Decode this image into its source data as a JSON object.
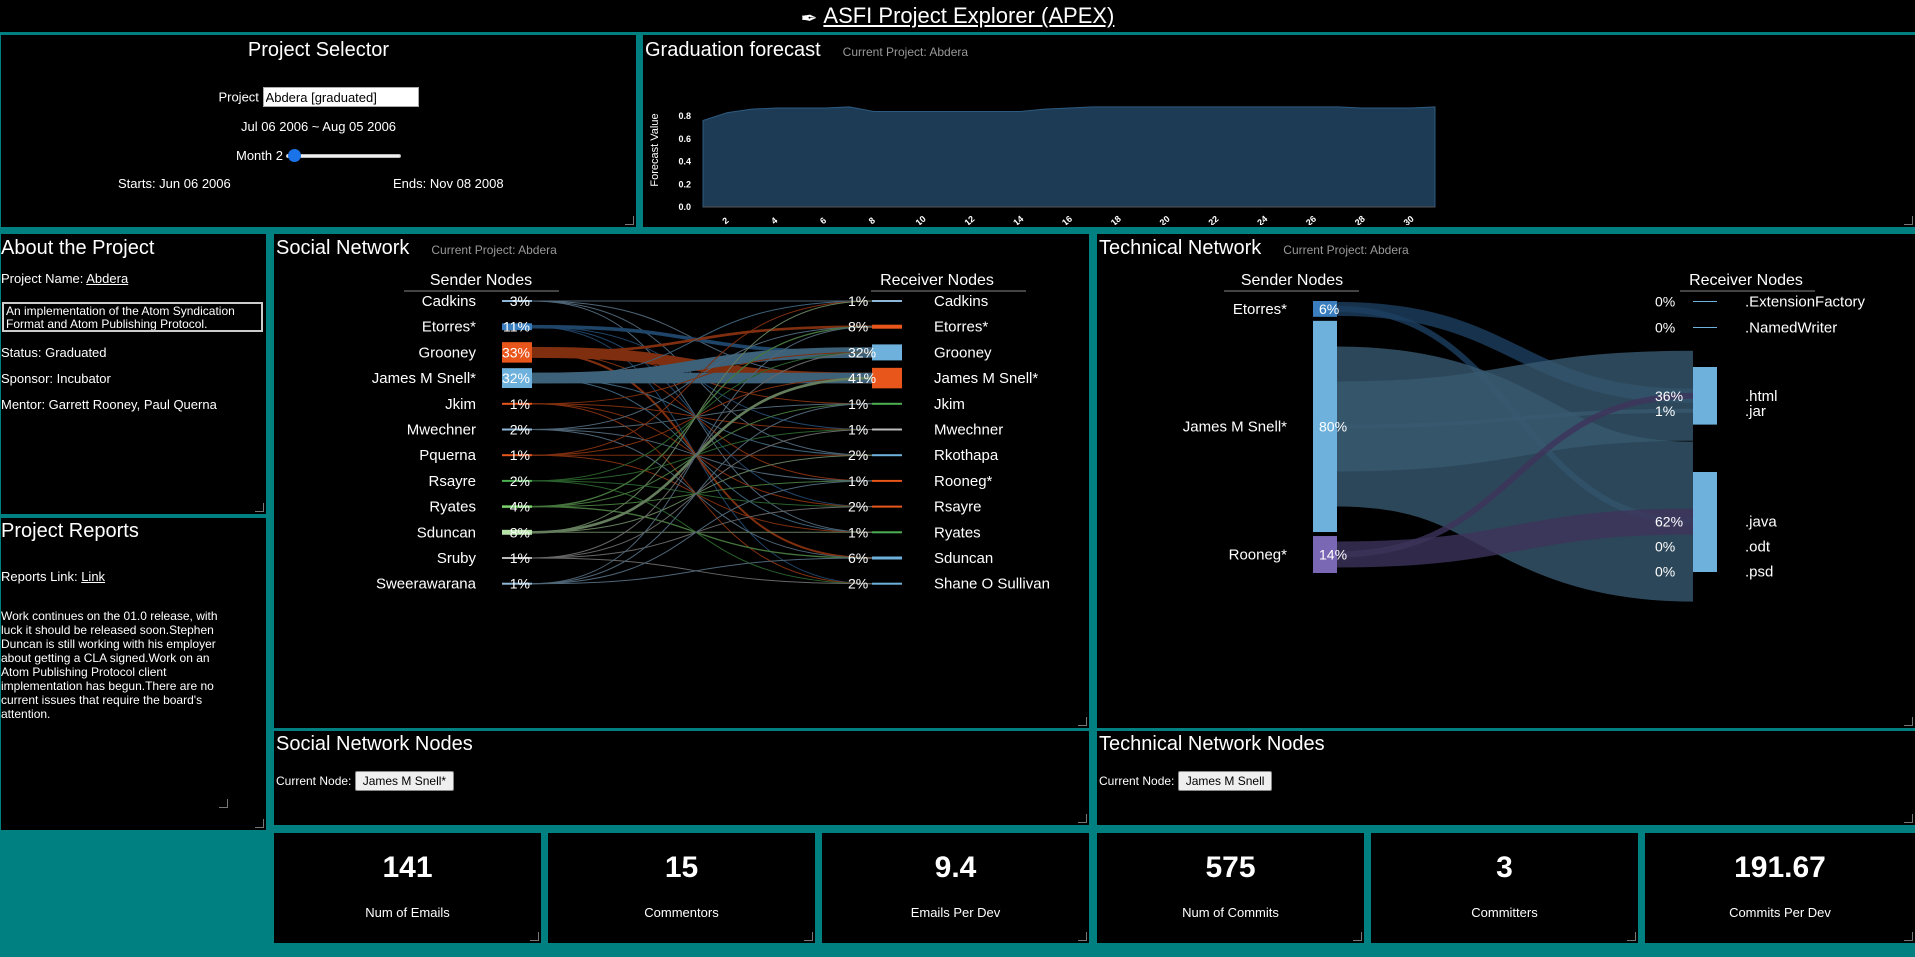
{
  "app": {
    "title": "ASFI Project Explorer (APEX)"
  },
  "selector": {
    "title": "Project Selector",
    "project_label": "Project",
    "project_value": "Abdera [graduated]",
    "range": "Jul 06 2006 ~ Aug 05 2006",
    "month_label": "Month 2",
    "month_progress": 0.02,
    "starts": "Starts: Jun 06 2006",
    "ends": "Ends: Nov 08 2008"
  },
  "forecast": {
    "title": "Graduation forecast",
    "subtitle": "Current Project:  Abdera",
    "chart_data": {
      "type": "area",
      "ylabel": "Forecast Value",
      "ylim": [
        0,
        1
      ],
      "yticks": [
        "0.0",
        "0.2",
        "0.4",
        "0.6",
        "0.8"
      ],
      "xticks": [
        "2",
        "4",
        "6",
        "8",
        "10",
        "12",
        "14",
        "16",
        "18",
        "20",
        "22",
        "24",
        "26",
        "28",
        "30"
      ],
      "x": [
        1,
        2,
        3,
        4,
        5,
        6,
        7,
        8,
        9,
        10,
        11,
        12,
        13,
        14,
        15,
        16,
        17,
        18,
        19,
        20,
        21,
        22,
        23,
        24,
        25,
        26,
        27,
        28,
        29,
        30,
        31
      ],
      "values": [
        0.76,
        0.83,
        0.86,
        0.87,
        0.87,
        0.87,
        0.88,
        0.84,
        0.84,
        0.84,
        0.84,
        0.84,
        0.84,
        0.84,
        0.86,
        0.87,
        0.88,
        0.88,
        0.88,
        0.88,
        0.88,
        0.88,
        0.88,
        0.88,
        0.88,
        0.88,
        0.88,
        0.87,
        0.87,
        0.87,
        0.88
      ],
      "color": "#1d3b55"
    }
  },
  "about": {
    "title": "About the Project",
    "name_label": "Project Name: ",
    "name": "Abdera",
    "description": "An implementation of the Atom Syndication Format and Atom Publishing Protocol.",
    "status": "Status: Graduated",
    "sponsor": "Sponsor: Incubator",
    "mentor": "Mentor: Garrett Rooney, Paul Querna"
  },
  "reports": {
    "title": "Project Reports",
    "link_label": "Reports Link: ",
    "link_text": "Link",
    "text": "Work continues on the 01.0 release, with luck it should be released soon.Stephen Duncan is still working with his employer about getting a CLA signed.Work on an Atom Publishing Protocol client implementation has begun.There are no current issues that require the board's attention."
  },
  "social": {
    "title": "Social Network",
    "subtitle": "Current Project:  Abdera",
    "sender_header": "Sender Nodes",
    "receiver_header": "Receiver Nodes",
    "senders": [
      {
        "name": "Cadkins",
        "pct": "3%",
        "value": 3,
        "color": "#8fb8d8"
      },
      {
        "name": "Etorres*",
        "pct": "11%",
        "value": 11,
        "color": "#3a7ebf"
      },
      {
        "name": "Grooney",
        "pct": "33%",
        "value": 33,
        "color": "#e8561c"
      },
      {
        "name": "James M Snell*",
        "pct": "32%",
        "value": 32,
        "color": "#6fb1dd"
      },
      {
        "name": "Jkim",
        "pct": "1%",
        "value": 1,
        "color": "#e8561c"
      },
      {
        "name": "Mwechner",
        "pct": "2%",
        "value": 2,
        "color": "#8fb8d8"
      },
      {
        "name": "Pquerna",
        "pct": "1%",
        "value": 1,
        "color": "#e8561c"
      },
      {
        "name": "Rsayre",
        "pct": "2%",
        "value": 2,
        "color": "#4caf50"
      },
      {
        "name": "Ryates",
        "pct": "4%",
        "value": 4,
        "color": "#7ed66f"
      },
      {
        "name": "Sduncan",
        "pct": "8%",
        "value": 8,
        "color": "#b6e3a8"
      },
      {
        "name": "Sruby",
        "pct": "1%",
        "value": 1,
        "color": "#bbbbbb"
      },
      {
        "name": "Sweerawarana",
        "pct": "1%",
        "value": 1,
        "color": "#8fb8d8"
      }
    ],
    "receivers": [
      {
        "name": "Cadkins",
        "pct": "1%",
        "value": 1,
        "color": "#8fb8d8"
      },
      {
        "name": "Etorres*",
        "pct": "8%",
        "value": 8,
        "color": "#e8561c"
      },
      {
        "name": "Grooney",
        "pct": "32%",
        "value": 32,
        "color": "#6fb1dd"
      },
      {
        "name": "James M Snell*",
        "pct": "41%",
        "value": 41,
        "color": "#e8561c"
      },
      {
        "name": "Jkim",
        "pct": "1%",
        "value": 1,
        "color": "#4caf50"
      },
      {
        "name": "Mwechner",
        "pct": "1%",
        "value": 1,
        "color": "#bbbbbb"
      },
      {
        "name": "Rkothapa",
        "pct": "2%",
        "value": 2,
        "color": "#6fb1dd"
      },
      {
        "name": "Rooneg*",
        "pct": "1%",
        "value": 1,
        "color": "#e8561c"
      },
      {
        "name": "Rsayre",
        "pct": "2%",
        "value": 2,
        "color": "#e8561c"
      },
      {
        "name": "Ryates",
        "pct": "1%",
        "value": 1,
        "color": "#4caf50"
      },
      {
        "name": "Sduncan",
        "pct": "6%",
        "value": 6,
        "color": "#6fb1dd"
      },
      {
        "name": "Shane O Sullivan",
        "pct": "2%",
        "value": 2,
        "color": "#6fb1dd"
      }
    ]
  },
  "technical": {
    "title": "Technical Network",
    "subtitle": "Current Project:  Abdera",
    "sender_header": "Sender Nodes",
    "receiver_header": "Receiver Nodes",
    "senders": [
      {
        "name": "Etorres*",
        "pct": "6%",
        "value": 6,
        "color": "#3a7ebf"
      },
      {
        "name": "James M Snell*",
        "pct": "80%",
        "value": 80,
        "color": "#6fb1dd"
      },
      {
        "name": "Rooneg*",
        "pct": "14%",
        "value": 14,
        "color": "#7b68b5"
      }
    ],
    "receivers": [
      {
        "name": ".ExtensionFactory",
        "pct": "0%",
        "value": 0
      },
      {
        "name": ".NamedWriter",
        "pct": "0%",
        "value": 0
      },
      {
        "name": ".html",
        "pct": "36%",
        "value": 36
      },
      {
        "name": ".jar",
        "pct": "1%",
        "value": 1
      },
      {
        "name": ".java",
        "pct": "62%",
        "value": 62
      },
      {
        "name": ".odt",
        "pct": "0%",
        "value": 0
      },
      {
        "name": ".psd",
        "pct": "0%",
        "value": 0
      }
    ]
  },
  "social_nodes": {
    "title": "Social Network Nodes",
    "label": "Current Node: ",
    "value": "James M Snell*"
  },
  "tech_nodes": {
    "title": "Technical Network Nodes",
    "label": "Current Node: ",
    "value": "James M Snell"
  },
  "kpis": [
    {
      "value": "141",
      "label": "Num of Emails"
    },
    {
      "value": "15",
      "label": "Commentors"
    },
    {
      "value": "9.4",
      "label": "Emails Per Dev"
    },
    {
      "value": "575",
      "label": "Num of Commits"
    },
    {
      "value": "3",
      "label": "Committers"
    },
    {
      "value": "191.67",
      "label": "Commits Per Dev"
    }
  ]
}
